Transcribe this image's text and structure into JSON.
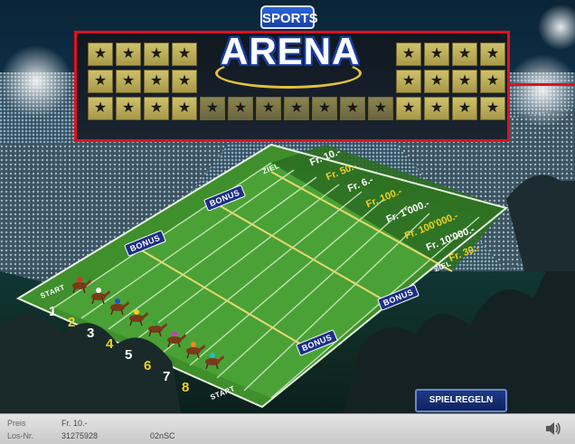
{
  "logo": {
    "top": "SPORTS",
    "main": "ARENA"
  },
  "scoreboard": {
    "star": "★"
  },
  "bonus_label": "BONUS",
  "prizes": [
    "Fr. 10.-",
    "Fr. 50.-",
    "Fr. 6.-",
    "Fr. 100.-",
    "Fr. 1'000.-",
    "Fr. 100'000.-",
    "Fr. 10'000.-",
    "Fr. 30.-"
  ],
  "labels": {
    "start": "START",
    "ziel": "ZIEL"
  },
  "lanes": [
    "1",
    "2",
    "3",
    "4",
    "5",
    "6",
    "7",
    "8"
  ],
  "rules_button": "SPIELREGELN",
  "footer": {
    "price_label": "Preis",
    "price_value": "Fr. 10.-",
    "los_label": "Los-Nr.",
    "los_value": "31275928",
    "code": "02nSC"
  },
  "colors": {
    "frame": "#e01020",
    "field": "#3f8f2c",
    "gold": "#f0d020",
    "rules": "#1e3a8a"
  }
}
